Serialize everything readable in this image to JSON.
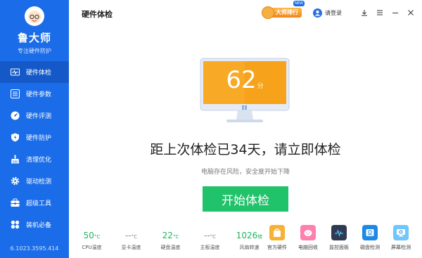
{
  "brand": {
    "name": "鲁大师",
    "tagline": "专注硬件防护"
  },
  "sidebar": {
    "items": [
      {
        "label": "硬件体检",
        "icon": "pulse-icon"
      },
      {
        "label": "硬件参数",
        "icon": "list-icon"
      },
      {
        "label": "硬件评测",
        "icon": "gauge-icon"
      },
      {
        "label": "硬件防护",
        "icon": "shield-icon"
      },
      {
        "label": "清理优化",
        "icon": "broom-icon"
      },
      {
        "label": "驱动检测",
        "icon": "gear-icon"
      },
      {
        "label": "超级工具",
        "icon": "toolbox-icon"
      },
      {
        "label": "装机必备",
        "icon": "apps-icon"
      }
    ],
    "version": "6.1023.3595.414"
  },
  "header": {
    "title": "硬件体检",
    "rank_label": "大师排行",
    "new_badge": "NEW",
    "login_label": "请登录"
  },
  "score": {
    "value": "62",
    "unit": "分"
  },
  "headline": "距上次体检已34天，请立即体检",
  "subline": "电脑存在风险，安全度开始下降",
  "start_button": "开始体检",
  "stats": [
    {
      "value": "50",
      "unit": "°C",
      "label": "CPU温度"
    },
    {
      "value": "--",
      "unit": "°C",
      "label": "显卡温度"
    },
    {
      "value": "22",
      "unit": "°C",
      "label": "硬盘温度"
    },
    {
      "value": "--",
      "unit": "°C",
      "label": "主板温度"
    },
    {
      "value": "1026",
      "unit": "转",
      "label": "风扇转速"
    }
  ],
  "tools": [
    {
      "label": "官方硬件",
      "icon": "shopping-bag-icon"
    },
    {
      "label": "电脑回收",
      "icon": "piggy-icon"
    },
    {
      "label": "监控面板",
      "icon": "monitor-panel-icon"
    },
    {
      "label": "磁盘检测",
      "icon": "disk-icon"
    },
    {
      "label": "屏幕检测",
      "icon": "screen-icon"
    }
  ],
  "colors": {
    "primary": "#1a6ce8",
    "accent_green": "#20c26a",
    "score_orange": "#f7a21b"
  }
}
